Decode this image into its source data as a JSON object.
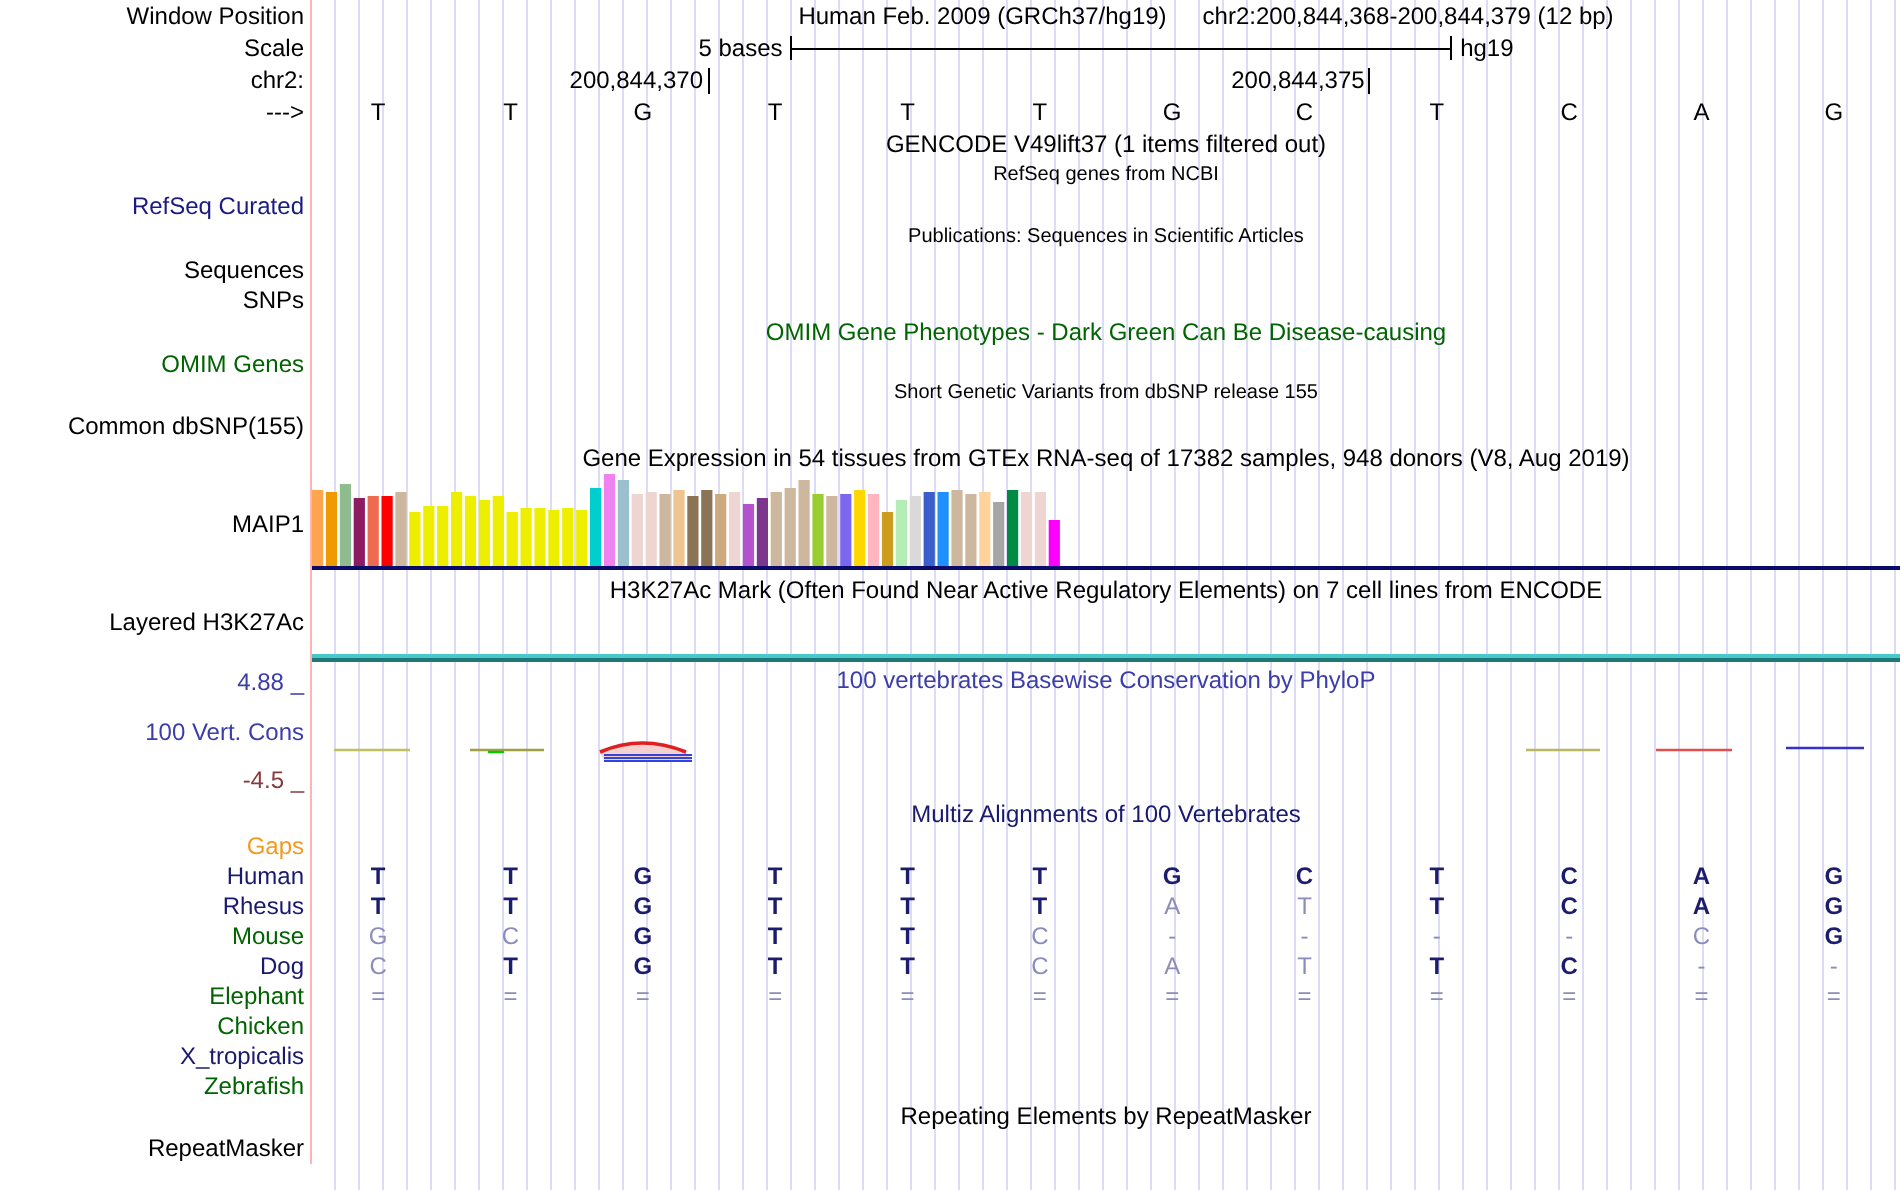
{
  "position": {
    "label": "Window Position",
    "assembly": "Human Feb. 2009 (GRCh37/hg19)",
    "range": "chr2:200,844,368-200,844,379 (12 bp)"
  },
  "scale": {
    "label": "Scale",
    "length": "5 bases",
    "assembly": "hg19"
  },
  "coordinates": {
    "label": "chr2:",
    "ticks": [
      "200,844,370",
      "200,844,375"
    ]
  },
  "sequence": {
    "label": "--->",
    "bases": [
      "T",
      "T",
      "G",
      "T",
      "T",
      "T",
      "G",
      "C",
      "T",
      "C",
      "A",
      "G"
    ]
  },
  "rows": [
    {
      "kind": "title",
      "text": "GENCODE V49lift37 (1 items filtered out)",
      "color": "#000000"
    },
    {
      "kind": "note",
      "text": "RefSeq genes from NCBI",
      "color": "#000000"
    },
    {
      "kind": "label",
      "text": "RefSeq Curated",
      "color": "#1a1a80"
    },
    {
      "kind": "note",
      "text": "Publications: Sequences in Scientific Articles",
      "color": "#000000"
    },
    {
      "kind": "label",
      "text": "Sequences",
      "color": "#000000"
    },
    {
      "kind": "label",
      "text": "SNPs",
      "color": "#000000"
    },
    {
      "kind": "title",
      "text": "OMIM Gene Phenotypes - Dark Green Can Be Disease-causing",
      "color": "#006400"
    },
    {
      "kind": "label",
      "text": "OMIM Genes",
      "color": "#006400"
    },
    {
      "kind": "note",
      "text": "Short Genetic Variants from dbSNP release 155",
      "color": "#000000"
    },
    {
      "kind": "label",
      "text": "Common dbSNP(155)",
      "color": "#000000"
    },
    {
      "kind": "title",
      "text": "Gene Expression in 54 tissues from GTEx RNA-seq of 17382 samples, 948 donors (V8, Aug 2019)",
      "color": "#000000"
    },
    {
      "kind": "expression",
      "text": "MAIP1",
      "color": "#000000"
    },
    {
      "kind": "title",
      "text": "H3K27Ac Mark (Often Found Near Active Regulatory Elements) on 7 cell lines from ENCODE",
      "color": "#000000"
    },
    {
      "kind": "label",
      "text": "Layered H3K27Ac",
      "color": "#000000"
    },
    {
      "kind": "signal"
    },
    {
      "kind": "conservation",
      "max": {
        "text": "4.88 _",
        "color": "#3c3caa"
      },
      "title": {
        "text": "100 vertebrates Basewise Conservation by PhyloP",
        "color": "#3c3caa"
      },
      "label": {
        "text": "100 Vert. Cons",
        "color": "#3c3caa"
      },
      "min": {
        "text": "-4.5 _",
        "color": "#8b3a3a"
      }
    },
    {
      "kind": "title",
      "text": "Multiz Alignments of 100 Vertebrates",
      "color": "#191970"
    },
    {
      "kind": "alignment",
      "gaps": {
        "text": "Gaps",
        "color": "#f39a1e"
      },
      "species": [
        {
          "name": "Human",
          "color": "#191970",
          "bases": [
            "T",
            "T",
            "G",
            "T",
            "T",
            "T",
            "G",
            "C",
            "T",
            "C",
            "A",
            "G"
          ],
          "matches": [
            true,
            true,
            true,
            true,
            true,
            true,
            true,
            true,
            true,
            true,
            true,
            true
          ]
        },
        {
          "name": "Rhesus",
          "color": "#191970",
          "bases": [
            "T",
            "T",
            "G",
            "T",
            "T",
            "T",
            "A",
            "T",
            "T",
            "C",
            "A",
            "G"
          ],
          "matches": [
            true,
            true,
            true,
            true,
            true,
            true,
            false,
            false,
            true,
            true,
            true,
            true
          ]
        },
        {
          "name": "Mouse",
          "color": "#006400",
          "bases": [
            "G",
            "C",
            "G",
            "T",
            "T",
            "C",
            "-",
            "-",
            "-",
            "-",
            "C",
            "G"
          ],
          "matches": [
            false,
            false,
            true,
            true,
            true,
            false,
            false,
            false,
            false,
            false,
            false,
            true
          ]
        },
        {
          "name": "Dog",
          "color": "#191970",
          "bases": [
            "C",
            "T",
            "G",
            "T",
            "T",
            "C",
            "A",
            "T",
            "T",
            "C",
            "-",
            "-"
          ],
          "matches": [
            false,
            true,
            true,
            true,
            true,
            false,
            false,
            false,
            true,
            true,
            false,
            false
          ]
        },
        {
          "name": "Elephant",
          "color": "#006400",
          "bases": [
            "=",
            "=",
            "=",
            "=",
            "=",
            "=",
            "=",
            "=",
            "=",
            "=",
            "=",
            "="
          ],
          "matches": [
            false,
            false,
            false,
            false,
            false,
            false,
            false,
            false,
            false,
            false,
            false,
            false
          ]
        },
        {
          "name": "Chicken",
          "color": "#006400"
        },
        {
          "name": "X_tropicalis",
          "color": "#191970"
        },
        {
          "name": "Zebrafish",
          "color": "#006400"
        }
      ]
    },
    {
      "kind": "title",
      "text": "Repeating Elements by RepeatMasker",
      "color": "#000000"
    },
    {
      "kind": "label",
      "text": "RepeatMasker",
      "color": "#000000"
    }
  ]
}
